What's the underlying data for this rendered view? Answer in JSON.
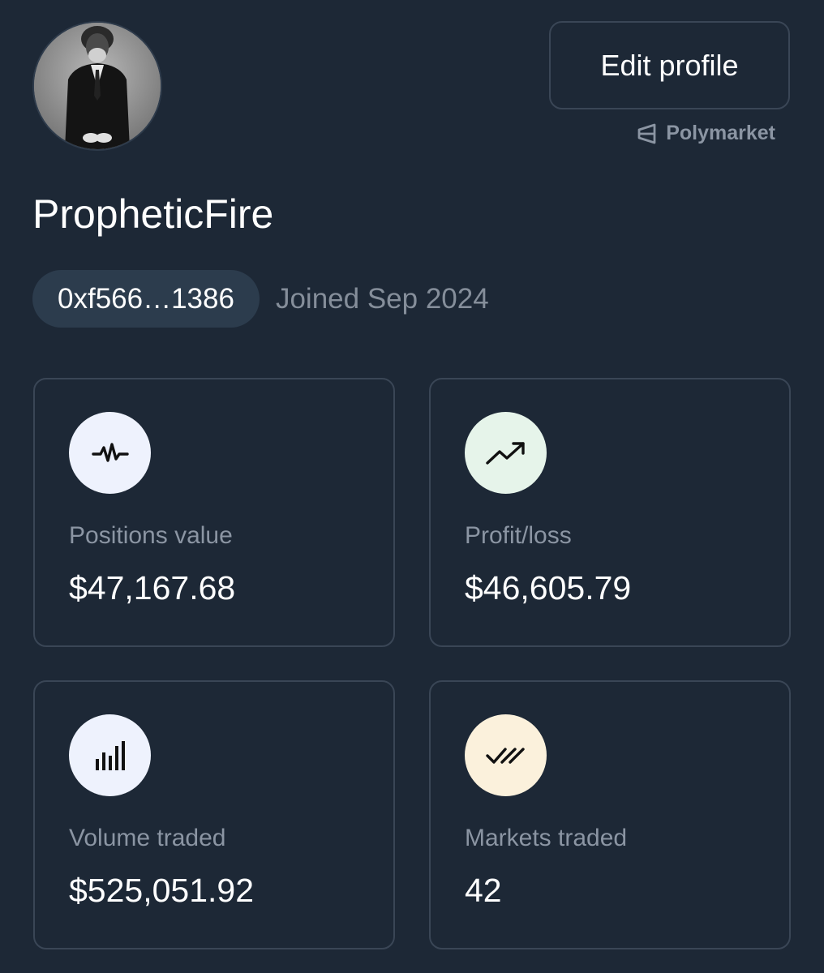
{
  "profile": {
    "username": "PropheticFire",
    "address": "0xf566…1386",
    "joined": "Joined Sep 2024",
    "edit_label": "Edit profile",
    "brand": "Polymarket"
  },
  "stats": [
    {
      "label": "Positions value",
      "value": "$47,167.68",
      "icon": "activity-pulse-icon",
      "icon_bg": "#eef2fd"
    },
    {
      "label": "Profit/loss",
      "value": "$46,605.79",
      "icon": "trending-up-icon",
      "icon_bg": "#e6f4ea"
    },
    {
      "label": "Volume traded",
      "value": "$525,051.92",
      "icon": "bar-chart-icon",
      "icon_bg": "#eef2fd"
    },
    {
      "label": "Markets traded",
      "value": "42",
      "icon": "double-check-icon",
      "icon_bg": "#fbf1dc"
    }
  ],
  "colors": {
    "background": "#1d2836",
    "border": "#3a4656",
    "muted_text": "#8b95a3",
    "chip_bg": "#2c3c4d"
  }
}
